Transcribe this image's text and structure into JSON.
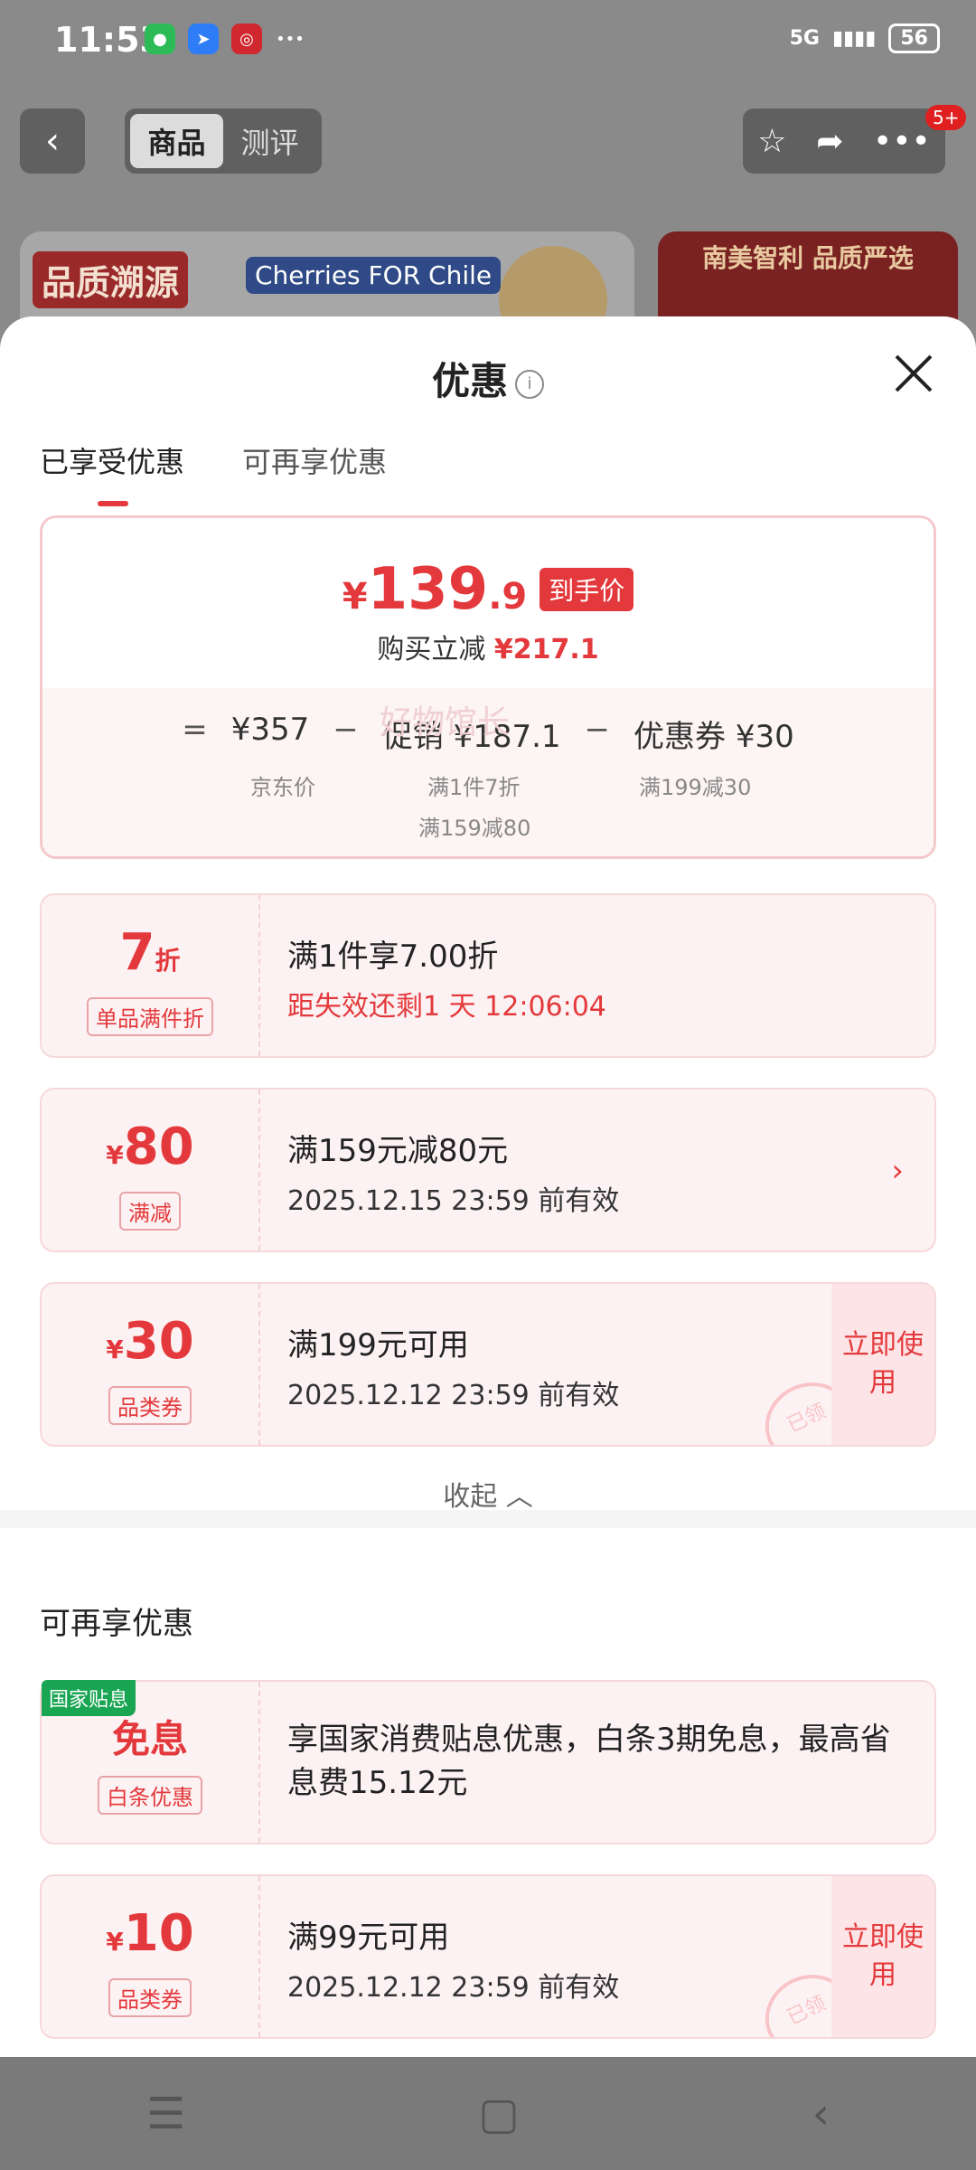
{
  "status": {
    "time": "11:53",
    "network": "5G",
    "battery": "56"
  },
  "topnav": {
    "back": "‹",
    "tabs": [
      "商品",
      "测评"
    ],
    "badge": "5+"
  },
  "banners": {
    "left_title": "品质溯源",
    "left_brand": "Cherries FOR Chile",
    "right_title": "南美智利 品质严选"
  },
  "sheet": {
    "title": "优惠",
    "tabs": [
      "已享受优惠",
      "可再享优惠"
    ]
  },
  "summary": {
    "price_yen": "¥",
    "price_int": "139",
    "price_dec": ".9",
    "price_tag": "到手价",
    "reduce_label": "购买立减",
    "reduce_value": "¥217.1",
    "formula": {
      "eq": "=",
      "jd": "¥357",
      "minus": "−",
      "promo": "促销 ¥187.1",
      "coupon": "优惠券 ¥30"
    },
    "sublabels": {
      "jd": "京东价",
      "promo1": "满1件7折",
      "promo2": "满159减80",
      "coupon": "满199减30"
    }
  },
  "cards": [
    {
      "amt": "7",
      "unit": "折",
      "label": "单品满件折",
      "main": "满1件享7.00折",
      "sub": "距失效还剩1 天 12:06:04"
    },
    {
      "amt": "80",
      "unit": "¥",
      "label": "满减",
      "main": "满159元减80元",
      "sub": "2025.12.15 23:59 前有效"
    },
    {
      "amt": "30",
      "unit": "¥",
      "label": "品类券",
      "main": "满199元可用",
      "sub": "2025.12.12 23:59 前有效",
      "action": "立即使用"
    }
  ],
  "watermark": "好物馆长",
  "collapse": "收起",
  "section2": {
    "title": "可再享优惠",
    "cards": [
      {
        "tag": "国家贴息",
        "amt": "免息",
        "label": "白条优惠",
        "main": "享国家消费贴息优惠，白条3期免息，最高省息费15.12元"
      },
      {
        "amt": "10",
        "unit": "¥",
        "label": "品类券",
        "main": "满99元可用",
        "sub": "2025.12.12 23:59 前有效",
        "action": "立即使用"
      }
    ]
  },
  "stamp": "已领"
}
